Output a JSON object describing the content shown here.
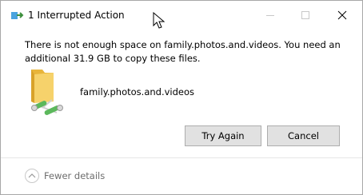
{
  "window": {
    "title": "1 Interrupted Action",
    "icons": {
      "app": "copy-arrow-icon",
      "minimize": "minimize-icon",
      "maximize": "maximize-icon",
      "close": "close-icon"
    }
  },
  "dialog": {
    "message": "There is not enough space on family.photos.and.videos. You need an additional 31.9 GB to copy these files.",
    "item_name": "family.photos.and.videos",
    "item_icon": "folder-network-icon",
    "buttons": {
      "try_again": "Try Again",
      "cancel": "Cancel"
    }
  },
  "footer": {
    "details_label": "Fewer details",
    "details_icon": "chevron-up-icon"
  },
  "colors": {
    "folder": "#f0c24a",
    "network_green": "#5cb85c",
    "button_bg": "#e1e1e1",
    "button_border": "#adadad",
    "muted_text": "#6d6d6d"
  }
}
